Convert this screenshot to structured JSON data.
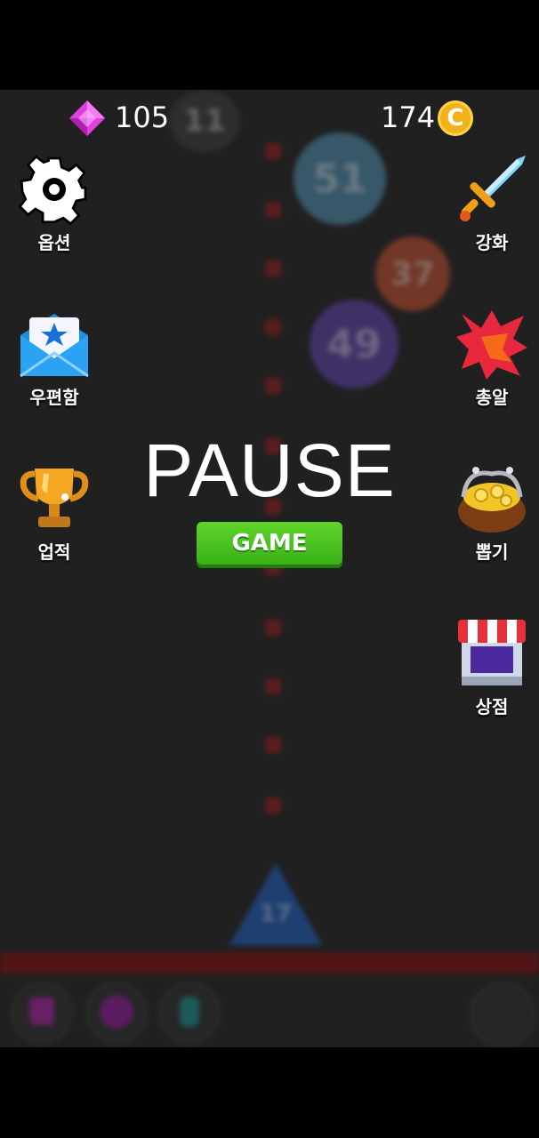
{
  "hud": {
    "gems": "105",
    "coins": "174",
    "coin_symbol": "C"
  },
  "menu_left": [
    {
      "label": "옵션",
      "icon": "gear-icon"
    },
    {
      "label": "우편함",
      "icon": "mail-icon"
    },
    {
      "label": "업적",
      "icon": "trophy-icon"
    }
  ],
  "menu_right": [
    {
      "label": "강화",
      "icon": "sword-icon"
    },
    {
      "label": "총알",
      "icon": "bullet-icon"
    },
    {
      "label": "뽑기",
      "icon": "treasure-bag-icon"
    },
    {
      "label": "상점",
      "icon": "shop-icon"
    }
  ],
  "pause": {
    "title": "PAUSE",
    "button": "GAME"
  },
  "background": {
    "ball_numbers": [
      "11",
      "51",
      "37",
      "49"
    ],
    "launcher_number": "17"
  },
  "colors": {
    "background": "#202021",
    "button_green": "#4ac620",
    "gem": "#e040e0",
    "coin": "#f1b21a"
  }
}
